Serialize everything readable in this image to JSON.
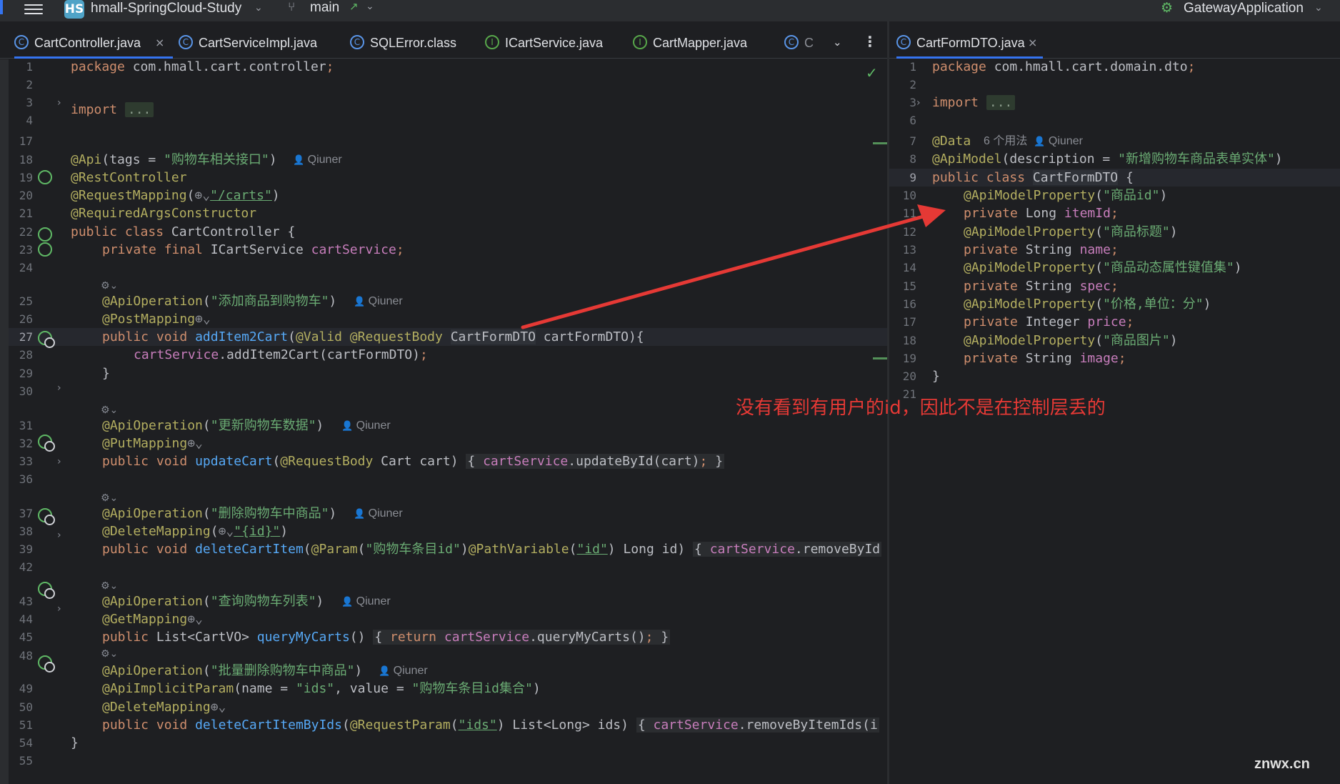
{
  "topbar": {
    "project_badge": "HS",
    "project_name": "hmall-SpringCloud-Study",
    "branch": "main",
    "branch_arrow": "↗",
    "run_config": "GatewayApplication"
  },
  "tabs_left": [
    {
      "label": "CartController.java",
      "icon": "class-icon",
      "active": true,
      "closable": true
    },
    {
      "label": "CartServiceImpl.java",
      "icon": "class-icon"
    },
    {
      "label": "SQLError.class",
      "icon": "class-icon"
    },
    {
      "label": "ICartService.java",
      "icon": "interface-icon"
    },
    {
      "label": "CartMapper.java",
      "icon": "interface-icon"
    },
    {
      "label": "C",
      "icon": "class-icon"
    }
  ],
  "tabs_right": [
    {
      "label": "CartFormDTO.java",
      "icon": "class-icon",
      "active": true,
      "closable": true
    }
  ],
  "left_editor": {
    "line_numbers": [
      "1",
      "2",
      "3",
      "4",
      "17",
      "18",
      "19",
      "20",
      "21",
      "22",
      "23",
      "24",
      "25",
      "26",
      "27",
      "28",
      "29",
      "30",
      "31",
      "32",
      "33",
      "36",
      "37",
      "38",
      "39",
      "42",
      "43",
      "44",
      "45",
      "48",
      "49",
      "50",
      "51",
      "54",
      "55"
    ],
    "package_kw": "package",
    "package_name": "com.hmall.cart.controller",
    "import_kw": "import",
    "import_fold": "...",
    "api_tags": "\"购物车相关接口\"",
    "author": "Qiuner",
    "mapping_path": "\"/carts\"",
    "class_name": "CartController",
    "service_field": "cartService",
    "service_type": "ICartService",
    "ops": {
      "add": "\"添加商品到购物车\"",
      "update": "\"更新购物车数据\"",
      "delete": "\"删除购物车中商品\"",
      "query": "\"查询购物车列表\"",
      "batch_delete": "\"批量删除购物车中商品\""
    },
    "method_add": "addItem2Cart",
    "method_update": "updateCart",
    "method_delete": "deleteCartItem",
    "method_query": "queryMyCarts",
    "method_batch": "deleteCartItemByIds",
    "param_id_desc": "\"购物车条目id\"",
    "path_id": "\"{id}\"",
    "implicit_value": "\"购物车条目id集合\"",
    "ids_name": "\"ids\""
  },
  "right_editor": {
    "line_numbers": [
      "1",
      "2",
      "3",
      "6",
      "7",
      "8",
      "9",
      "10",
      "11",
      "12",
      "13",
      "14",
      "15",
      "16",
      "17",
      "18",
      "19",
      "20",
      "21"
    ],
    "package_name": "com.hmall.cart.domain.dto",
    "usages_hint": "6 个用法",
    "author": "Qiuner",
    "model_desc": "\"新增购物车商品表单实体\"",
    "class_name": "CartFormDTO",
    "props": [
      {
        "desc": "\"商品id\"",
        "type": "Long",
        "name": "itemId"
      },
      {
        "desc": "\"商品标题\"",
        "type": "String",
        "name": "name"
      },
      {
        "desc": "\"商品动态属性键值集\"",
        "type": "String",
        "name": "spec"
      },
      {
        "desc": "\"价格,单位：分\"",
        "type": "Integer",
        "name": "price"
      },
      {
        "desc": "\"商品图片\"",
        "type": "String",
        "name": "image"
      }
    ]
  },
  "annotation": {
    "text": "没有看到有用户的id，因此不是在控制层丢的",
    "color": "#e53935"
  },
  "watermark": "znwx.cn",
  "colors": {
    "keyword": "#cf8e6d",
    "string": "#6aab73",
    "annotation": "#b3ae60",
    "method": "#56a8f5",
    "field": "#c77dbb",
    "accent": "#3574f0"
  }
}
